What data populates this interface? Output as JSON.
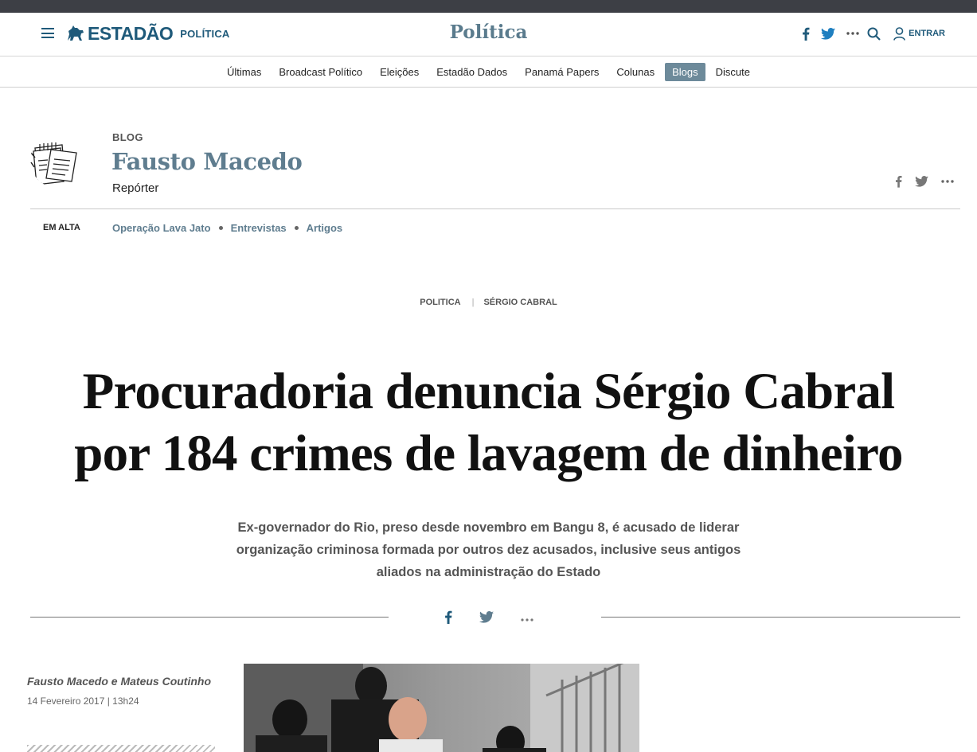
{
  "header": {
    "logo_text": "ESTADÃO",
    "logo_section": "POLÍTICA",
    "section_title": "Política",
    "login_label": "ENTRAR",
    "icons": [
      "menu-icon",
      "facebook-icon",
      "twitter-icon",
      "more-icon",
      "search-icon",
      "user-icon"
    ],
    "brand_color": "#1f5a7a"
  },
  "nav": {
    "items": [
      {
        "label": "Últimas"
      },
      {
        "label": "Broadcast Político"
      },
      {
        "label": "Eleições"
      },
      {
        "label": "Estadão Dados"
      },
      {
        "label": "Panamá Papers"
      },
      {
        "label": "Colunas"
      },
      {
        "label": "Blogs",
        "active": true
      },
      {
        "label": "Discute"
      }
    ],
    "active_color": "#6d8a9a"
  },
  "blog": {
    "label": "BLOG",
    "name": "Fausto Macedo",
    "role": "Repórter"
  },
  "trending": {
    "label": "EM ALTA",
    "items": [
      "Operação Lava Jato",
      "Entrevistas",
      "Artigos"
    ]
  },
  "article": {
    "tags": [
      "POLITICA",
      "SÉRGIO CABRAL"
    ],
    "headline_line1": "Procuradoria denuncia Sérgio Cabral",
    "headline_line2": "por 184 crimes de lavagem de dinheiro",
    "lead": "Ex-governador do Rio, preso desde novembro em Bangu 8, é acusado de liderar organização criminosa formada por outros dez acusados, inclusive seus antigos aliados na administração do Estado",
    "authors": "Fausto Macedo e Mateus Coutinho",
    "date": "14 Fevereiro 2017 | 13h24"
  }
}
